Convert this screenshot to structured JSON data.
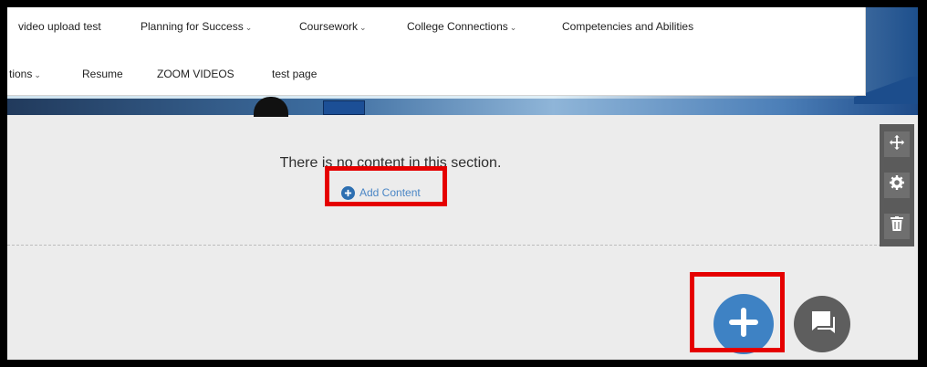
{
  "nav": {
    "row1": [
      {
        "label": "video upload test",
        "caret": ""
      },
      {
        "label": "Planning for Success",
        "caret": "⌄"
      },
      {
        "label": "Coursework",
        "caret": "⌄"
      },
      {
        "label": "College Connections",
        "caret": "⌄"
      },
      {
        "label": "Competencies and Abilities",
        "caret": ""
      }
    ],
    "row2": [
      {
        "label": "tions",
        "caret": "⌄"
      },
      {
        "label": "Resume",
        "caret": ""
      },
      {
        "label": "ZOOM VIDEOS",
        "caret": ""
      },
      {
        "label": "test page",
        "caret": ""
      }
    ]
  },
  "section": {
    "empty_message": "There is no content in this section.",
    "add_content_label": "Add Content"
  },
  "tools": [
    "move-icon",
    "gear-icon",
    "trash-icon"
  ],
  "fabs": {
    "add": "plus-icon",
    "chat": "chat-icon"
  },
  "colors": {
    "accent_blue": "#3e82c4",
    "highlight_red": "#e50000",
    "tool_bg": "#5b5b5b"
  }
}
